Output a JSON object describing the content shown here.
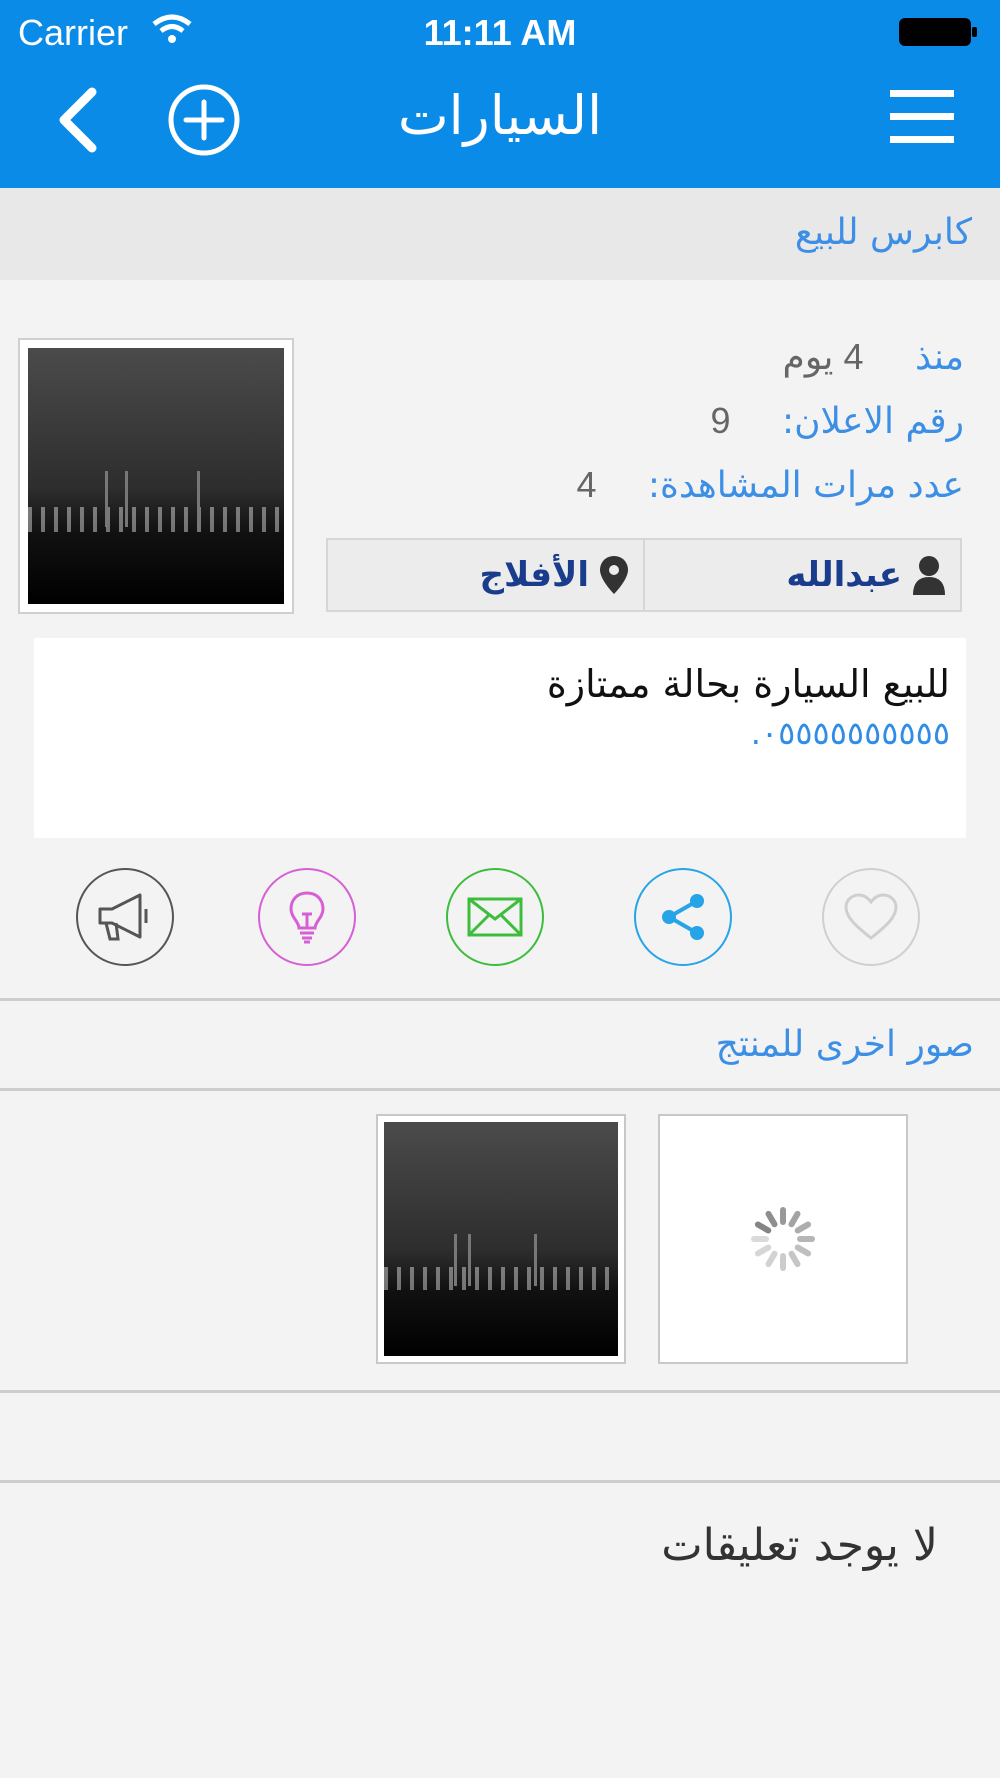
{
  "status_bar": {
    "carrier": "Carrier",
    "time": "11:11 AM"
  },
  "nav": {
    "title": "السيارات"
  },
  "listing": {
    "title": "كابرس للبيع",
    "since_label": "منذ",
    "since_value": "4 يوم",
    "ad_number_label": "رقم الاعلان:",
    "ad_number_value": "9",
    "views_label": "عدد مرات المشاهدة:",
    "views_value": "4",
    "user_name": "عبدالله",
    "location": "الأفلاج",
    "description": "للبيع السيارة بحالة ممتازة",
    "phone": "٠٥٥٥٥٥٥٥٥٥٥."
  },
  "actions": [
    {
      "name": "favorite",
      "icon": "heart-icon",
      "color": "#cfcfcf"
    },
    {
      "name": "share",
      "icon": "share-icon",
      "color": "#27a3e8"
    },
    {
      "name": "message",
      "icon": "envelope-icon",
      "color": "#3cbd3c"
    },
    {
      "name": "tip",
      "icon": "lightbulb-icon",
      "color": "#d65fd6"
    },
    {
      "name": "report",
      "icon": "megaphone-icon",
      "color": "#555555"
    }
  ],
  "other_images": {
    "label": "صور اخرى للمنتج"
  },
  "comments": {
    "empty_text": "لا يوجد تعليقات"
  },
  "colors": {
    "header": "#0a8be8",
    "accent": "#3d8fe6",
    "user": "#1a3c8c"
  }
}
